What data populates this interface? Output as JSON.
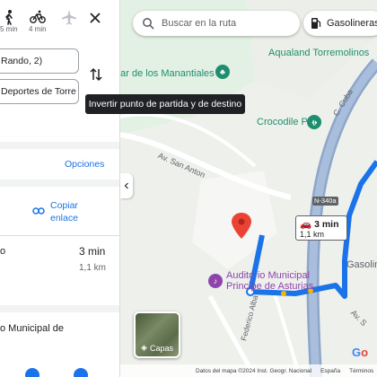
{
  "panel": {
    "modes": [
      {
        "icon": "walk-icon",
        "label": "5 min"
      },
      {
        "icon": "bike-icon",
        "label": "4 min"
      },
      {
        "icon": "plane-icon",
        "label": ""
      }
    ],
    "origin_value": "Rando, 2)",
    "destination_value": "Deportes de Torre",
    "options_label": "Opciones",
    "copy_link_label": "Copiar enlace",
    "summary_text": "o",
    "summary_time": "3 min",
    "summary_distance": "1,1 km",
    "destination_title": "o Municipal de"
  },
  "tooltip": "Invertir punto de partida y de destino",
  "map": {
    "search_placeholder": "Buscar en la ruta",
    "gas_chip_label": "Gasolineras",
    "labels": {
      "aqualand": "Aqualand Torremolinos",
      "manantiales": "nar de los Manantiales",
      "crocodile": "Crocodile Park",
      "avenida_san_anton": "Av. San Anton",
      "calle_cuba": "C. Cuba",
      "n340": "N-340a",
      "gasolineras": "Gasolineras",
      "auditorio_line1": "Auditorio Municipal",
      "auditorio_line2": "Principe de Asturias",
      "federico": "Federico Alba",
      "avenida_s": "Av. S"
    },
    "route": {
      "time": "3 min",
      "distance": "1,1 km"
    },
    "layers_label": "Capas",
    "attribution": [
      "Datos del mapa ©2024 Inst. Geogr. Nacional",
      "España",
      "Términos"
    ],
    "google_logo": "Go"
  },
  "colors": {
    "route_blue": "#1a73e8",
    "pin_red": "#ea4335",
    "link_blue": "#1a73e8",
    "green_label": "#1e8e6e"
  }
}
